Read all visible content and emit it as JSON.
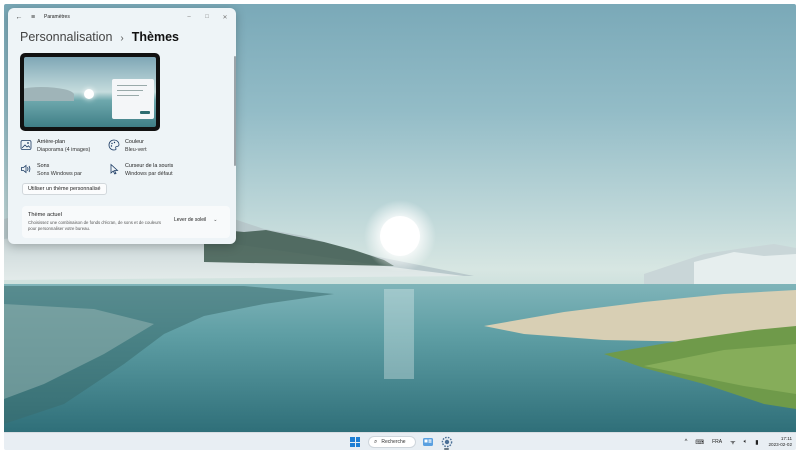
{
  "window": {
    "app_title": "Paramètres",
    "back_icon": "back-arrow-icon",
    "menu_icon": "hamburger-icon",
    "controls": {
      "minimize": "–",
      "maximize": "□",
      "close": "✕"
    }
  },
  "breadcrumb": {
    "parent": "Personnalisation",
    "separator": "›",
    "current": "Thèmes"
  },
  "options": {
    "background": {
      "title": "Arrière-plan",
      "value": "Diaporama (4 images)",
      "icon": "image-icon"
    },
    "color": {
      "title": "Couleur",
      "value": "Bleu-vert",
      "icon": "palette-icon"
    },
    "sounds": {
      "title": "Sons",
      "value": "Sons Windows par",
      "icon": "speaker-icon"
    },
    "cursor": {
      "title": "Curseur de la souris",
      "value": "Windows par défaut",
      "icon": "cursor-icon"
    }
  },
  "custom_theme_button": "Utiliser un thème personnalisé",
  "current_theme": {
    "title": "Thème actuel",
    "description": "Choisissez une combinaison de fonds d’écran, de sons et de couleurs pour personnaliser votre bureau.",
    "selected": "Lever de soleil"
  },
  "taskbar": {
    "search_label": "Recherche",
    "language": "FRA",
    "time": "17:11",
    "date": "2023-02-02"
  },
  "colors": {
    "accent": "#1e7fd4",
    "window_bg": "#eef4f7",
    "taskbar_bg": "#e8eef3"
  }
}
